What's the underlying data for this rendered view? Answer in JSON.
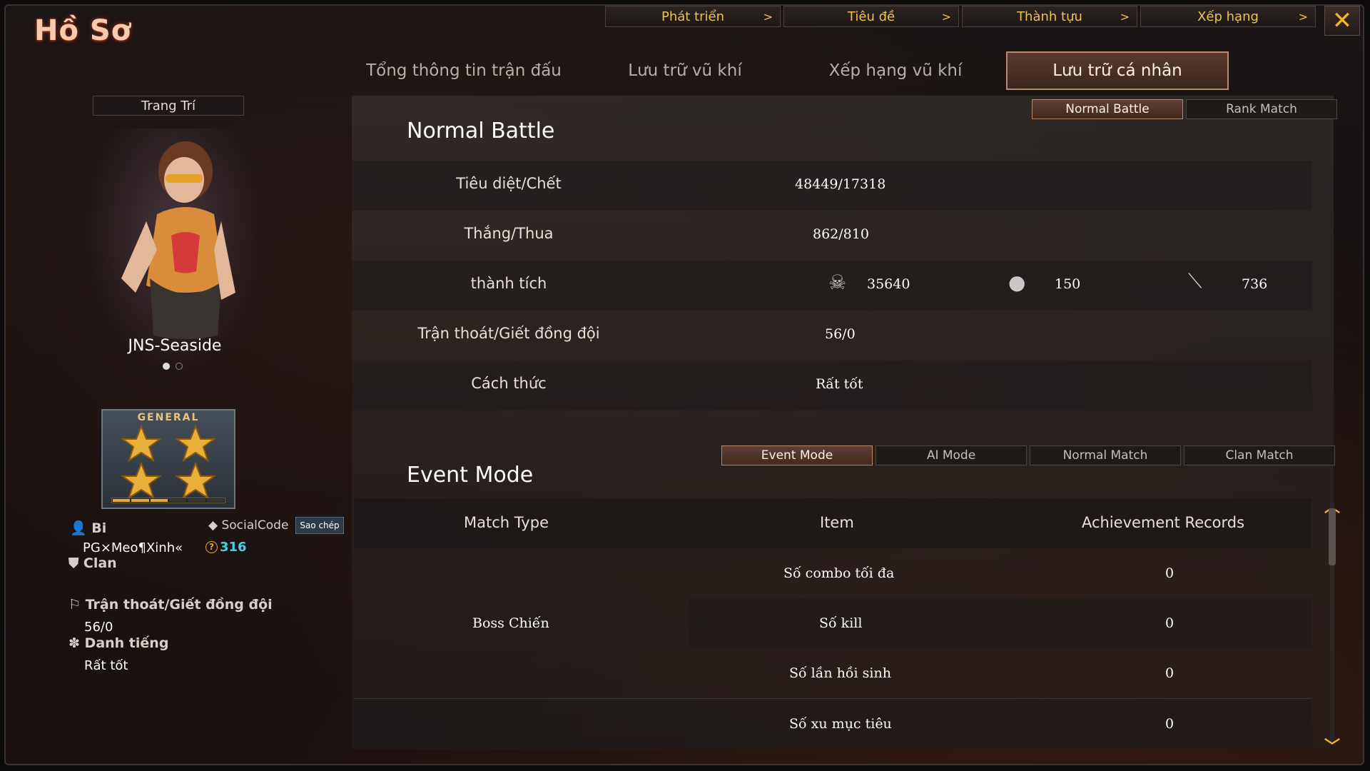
{
  "window": {
    "title": "Hồ Sơ",
    "close_symbol": "✕"
  },
  "top_tabs": [
    {
      "label": "Phát triển"
    },
    {
      "label": "Tiêu đề"
    },
    {
      "label": "Thành tựu"
    },
    {
      "label": "Xếp hạng"
    }
  ],
  "chevron": ">",
  "main_tabs": [
    {
      "label": "Tổng thông tin trận đấu"
    },
    {
      "label": "Lưu trữ vũ khí"
    },
    {
      "label": "Xếp hạng vũ khí"
    },
    {
      "label": "Lưu trữ cá nhân",
      "active": true
    }
  ],
  "profile": {
    "decoration_label": "Trang Trí",
    "character_name": "JNS-Seaside",
    "rank_title": "GENERAL",
    "rank_progress_filled": 3,
    "rank_progress_total": 6,
    "player_label": "Bi",
    "player_name": "PG×Meo¶Xinh«",
    "social_code_label": "SocialCode",
    "copy_label": "Sao chép",
    "coin_value": "316",
    "clan_label": "Clan",
    "escape_label": "Trận thoát/Giết đồng đội",
    "escape_value": "56/0",
    "reputation_label": "Danh tiếng",
    "reputation_value": "Rất tốt"
  },
  "battle_tabs": [
    {
      "label": "Normal Battle",
      "active": true
    },
    {
      "label": "Rank Match"
    }
  ],
  "normal_battle": {
    "title": "Normal Battle",
    "rows": [
      {
        "label": "Tiêu diệt/Chết",
        "value": "48449/17318"
      },
      {
        "label": "Thắng/Thua",
        "value": "862/810"
      },
      {
        "label": "thành tích",
        "value": ""
      },
      {
        "label": "Trận thoát/Giết đồng đội",
        "value": "56/0"
      },
      {
        "label": "Cách thức",
        "value": "Rất tốt"
      }
    ],
    "achievements": [
      {
        "icon": "skull-crossbones-icon",
        "value": "35640"
      },
      {
        "icon": "grenade-icon",
        "value": "150"
      },
      {
        "icon": "knife-icon",
        "value": "736"
      }
    ]
  },
  "mode_tabs": [
    {
      "label": "Event Mode",
      "active": true
    },
    {
      "label": "AI Mode"
    },
    {
      "label": "Normal Match"
    },
    {
      "label": "Clan Match"
    }
  ],
  "event_mode": {
    "title": "Event Mode",
    "columns": [
      "Match Type",
      "Item",
      "Achievement Records"
    ],
    "match_type": "Boss Chiến",
    "rows": [
      {
        "item": "Số combo tối đa",
        "record": "0"
      },
      {
        "item": "Số kill",
        "record": "0"
      },
      {
        "item": "Số lần hồi sinh",
        "record": "0"
      },
      {
        "item": "Số xu mục tiêu",
        "record": "0"
      }
    ]
  },
  "colors": {
    "accent_gold": "#f1c24a",
    "active_tab": "#5a3a30",
    "coin_cyan": "#3fd3e6"
  }
}
